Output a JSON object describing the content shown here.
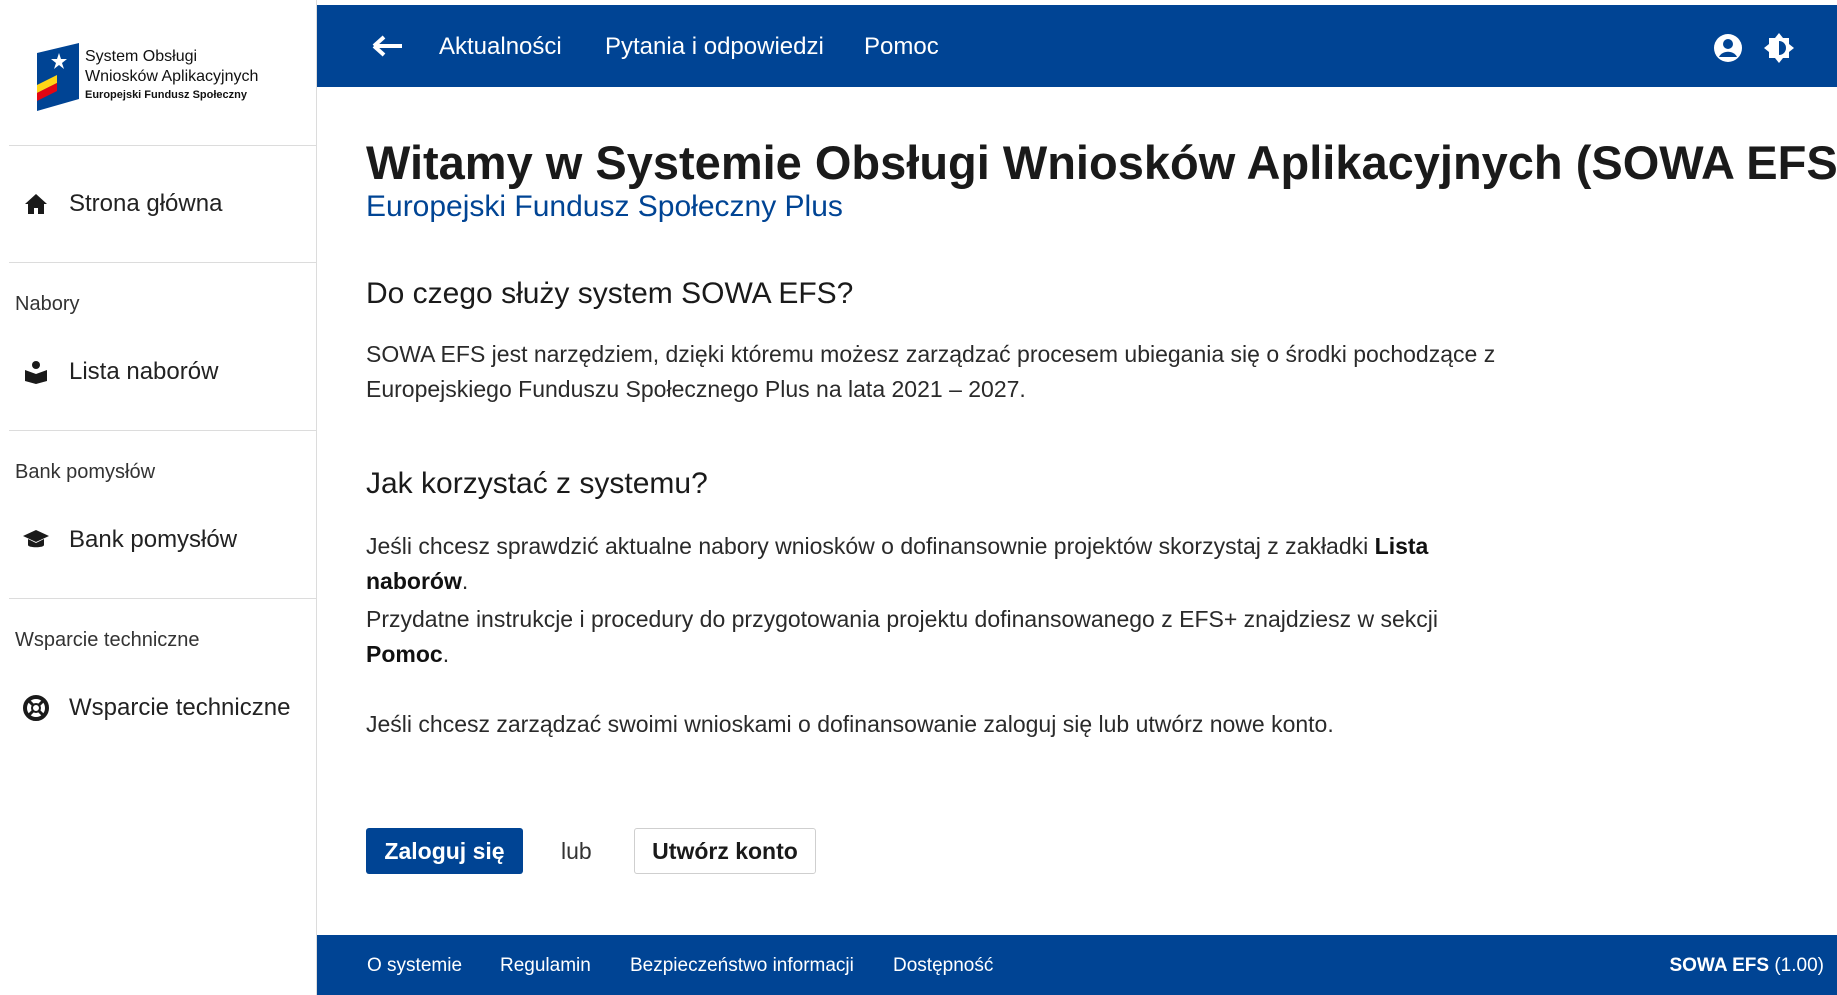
{
  "logo": {
    "line1": "System Obsługi",
    "line2": "Wniosków Aplikacyjnych",
    "line3": "Europejski Fundusz Społeczny"
  },
  "sidebar": {
    "home": {
      "label": "Strona główna",
      "icon": "home-icon"
    },
    "sections": [
      {
        "title": "Nabory",
        "item": {
          "label": "Lista naborów",
          "icon": "book-reader-icon"
        }
      },
      {
        "title": "Bank pomysłów",
        "item": {
          "label": "Bank pomysłów",
          "icon": "graduation-cap-icon"
        }
      },
      {
        "title": "Wsparcie techniczne",
        "item": {
          "label": "Wsparcie techniczne",
          "icon": "life-ring-icon"
        }
      }
    ]
  },
  "topbar": {
    "links": [
      "Aktualności",
      "Pytania i odpowiedzi",
      "Pomoc"
    ],
    "icons": [
      "user-circle-icon",
      "brightness-icon"
    ]
  },
  "main": {
    "title": "Witamy w Systemie Obsługi Wniosków Aplikacyjnych (SOWA EFS)",
    "subtitle": "Europejski Fundusz Społeczny Plus",
    "section1": {
      "heading": "Do czego służy system SOWA EFS?",
      "text": "SOWA EFS jest narzędziem, dzięki któremu możesz zarządzać procesem ubiegania się o środki pochodzące z Europejskiego Funduszu Społecznego Plus na lata 2021 – 2027."
    },
    "section2": {
      "heading": "Jak korzystać z systemu?",
      "p1_text": "Jeśli chcesz sprawdzić aktualne nabory wniosków o dofinansownie projektów skorzystaj z zakładki ",
      "p1_bold": "Lista naborów",
      "p1_end": ".",
      "p2_text": "Przydatne instrukcje i procedury do przygotowania projektu dofinansowanego z EFS+ znajdziesz w sekcji ",
      "p2_bold": "Pomoc",
      "p2_end": ".",
      "p3_text": "Jeśli chcesz zarządzać swoimi wnioskami o dofinansowanie zaloguj się lub utwórz nowe konto."
    },
    "login_label": "Zaloguj się",
    "or_label": "lub",
    "register_label": "Utwórz konto"
  },
  "footer": {
    "links": [
      "O systemie",
      "Regulamin",
      "Bezpieczeństwo informacji",
      "Dostępność"
    ],
    "version_name": "SOWA EFS",
    "version_number": "(1.00)"
  },
  "colors": {
    "brand_blue": "#004494",
    "flag_yellow": "#ffd617",
    "flag_red": "#e30613"
  }
}
